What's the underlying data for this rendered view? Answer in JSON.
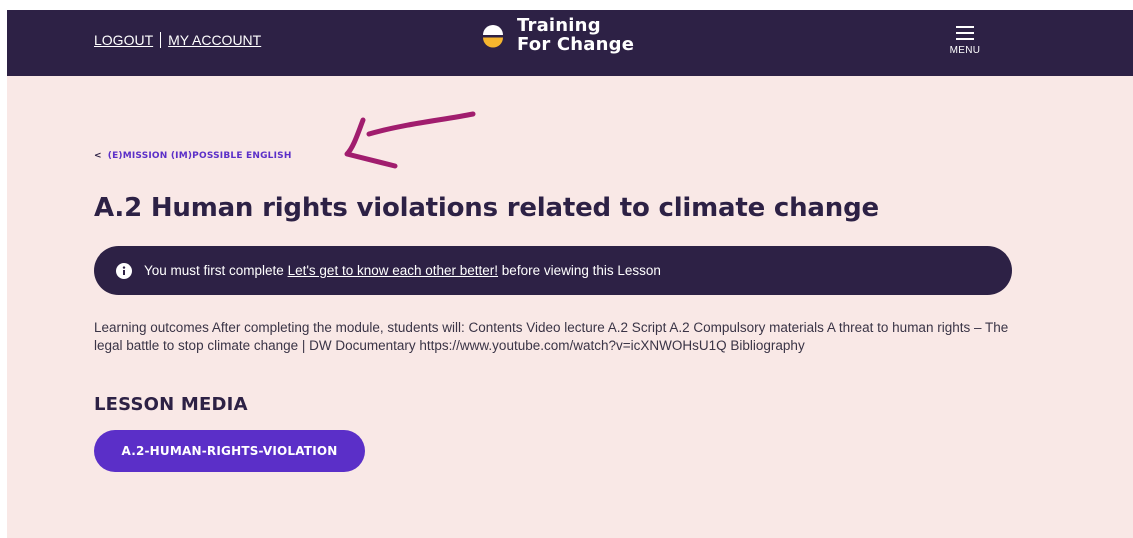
{
  "header": {
    "logout_label": "LOGOUT",
    "account_label": "MY ACCOUNT",
    "brand_line1": "Training",
    "brand_line2": "For Change",
    "menu_label": "MENU",
    "brand_icon": "half-circle-logo-icon",
    "menu_icon": "hamburger-icon"
  },
  "breadcrumb": {
    "chevron": "<",
    "label": "(E)MISSION (IM)POSSIBLE ENGLISH"
  },
  "annotation": {
    "icon": "hand-drawn-arrow-icon",
    "color": "#a11d6e"
  },
  "lesson": {
    "title": "A.2 Human rights violations related to climate change",
    "notice": {
      "icon": "info-icon",
      "prefix": "You must first complete ",
      "link_text": "Let's get to know each other better!",
      "suffix": " before viewing this Lesson"
    },
    "description": "Learning outcomes After completing the module, students will: Contents Video lecture A.2 Script A.2 Compulsory materials A threat to human rights – The legal battle to stop climate change | DW Documentary https://www.youtube.com/watch?v=icXNWOHsU1Q Bibliography",
    "media_heading": "LESSON MEDIA",
    "media_button_label": "A.2-HUMAN-RIGHTS-VIOLATION"
  },
  "colors": {
    "header_bg": "#2d2145",
    "page_bg": "#f9e8e6",
    "accent": "#5b2fc8",
    "logo_yellow": "#f5b52e"
  }
}
